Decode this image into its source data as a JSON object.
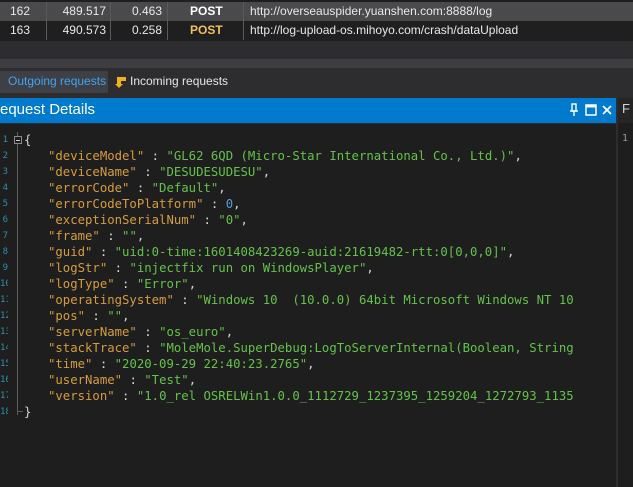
{
  "requests": [
    {
      "id": "162",
      "time": "489.517",
      "duration": "0.463",
      "method": "POST",
      "url": "http://overseauspider.yuanshen.com:8888/log"
    },
    {
      "id": "163",
      "time": "490.573",
      "duration": "0.258",
      "method": "POST",
      "url": "http://log-upload-os.mihoyo.com/crash/dataUpload"
    }
  ],
  "tabs": [
    {
      "label": "Outgoing requests",
      "icon": "outgoing-icon",
      "active": true
    },
    {
      "label": "Incoming requests",
      "icon": "incoming-arrow-icon",
      "active": false
    }
  ],
  "panel": {
    "title": "equest Details",
    "controls": [
      "pin-icon",
      "maximize-icon",
      "close-icon"
    ]
  },
  "right_panel": {
    "header": "F",
    "line_number": "1"
  },
  "colors": {
    "accent": "#007acc",
    "key": "#d69d3c",
    "string": "#64c24a",
    "number": "#569cd6",
    "method_highlight": "#f0c060"
  },
  "code": {
    "open_brace": "{",
    "close_brace": "}",
    "line_numbers": [
      "1",
      "2",
      "3",
      "4",
      "5",
      "6",
      "7",
      "8",
      "9",
      "10",
      "11",
      "12",
      "13",
      "14",
      "15",
      "16",
      "17",
      "18"
    ],
    "lines": [
      {
        "key": "\"deviceModel\"",
        "sep": " : ",
        "value": "\"GL62 6QD (Micro-Star International Co., Ltd.)\"",
        "type": "str",
        "tail": ","
      },
      {
        "key": "\"deviceName\"",
        "sep": " : ",
        "value": "\"DESUDESUDESU\"",
        "type": "str",
        "tail": ","
      },
      {
        "key": "\"errorCode\"",
        "sep": " : ",
        "value": "\"Default\"",
        "type": "str",
        "tail": ","
      },
      {
        "key": "\"errorCodeToPlatform\"",
        "sep": " : ",
        "value": "0",
        "type": "num",
        "tail": ","
      },
      {
        "key": "\"exceptionSerialNum\"",
        "sep": " : ",
        "value": "\"0\"",
        "type": "str",
        "tail": ","
      },
      {
        "key": "\"frame\"",
        "sep": " : ",
        "value": "\"\"",
        "type": "str",
        "tail": ","
      },
      {
        "key": "\"guid\"",
        "sep": " : ",
        "value": "\"uid:0-time:1601408423269-auid:21619482-rtt:0[0,0,0]\"",
        "type": "str",
        "tail": ","
      },
      {
        "key": "\"logStr\"",
        "sep": " : ",
        "value": "\"injectfix run on WindowsPlayer\"",
        "type": "str",
        "tail": ","
      },
      {
        "key": "\"logType\"",
        "sep": " : ",
        "value": "\"Error\"",
        "type": "str",
        "tail": ","
      },
      {
        "key": "\"operatingSystem\"",
        "sep": " : ",
        "value": "\"Windows 10  (10.0.0) 64bit Microsoft Windows NT 10",
        "type": "str",
        "tail": ""
      },
      {
        "key": "\"pos\"",
        "sep": " : ",
        "value": "\"\"",
        "type": "str",
        "tail": ","
      },
      {
        "key": "\"serverName\"",
        "sep": " : ",
        "value": "\"os_euro\"",
        "type": "str",
        "tail": ","
      },
      {
        "key": "\"stackTrace\"",
        "sep": " : ",
        "value": "\"MoleMole.SuperDebug:LogToServerInternal(Boolean, String",
        "type": "str",
        "tail": ""
      },
      {
        "key": "\"time\"",
        "sep": " : ",
        "value": "\"2020-09-29 22:40:23.2765\"",
        "type": "str",
        "tail": ","
      },
      {
        "key": "\"userName\"",
        "sep": " : ",
        "value": "\"Test\"",
        "type": "str",
        "tail": ","
      },
      {
        "key": "\"version\"",
        "sep": " : ",
        "value": "\"1.0_rel OSRELWin1.0.0_1112729_1237395_1259204_1272793_1135",
        "type": "str",
        "tail": ""
      }
    ]
  }
}
